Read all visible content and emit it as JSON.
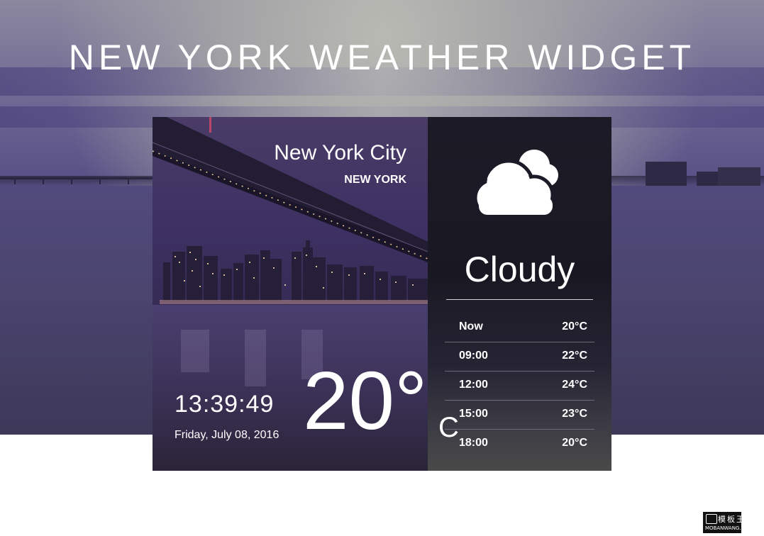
{
  "page": {
    "title": "NEW YORK WEATHER WIDGET"
  },
  "location": {
    "city": "New York City",
    "state": "NEW YORK"
  },
  "time": {
    "clock": "13:39:49",
    "date": "Friday, July 08, 2016"
  },
  "current": {
    "temperature": "20°",
    "unit": "C",
    "condition": "Cloudy",
    "icon": "cloud-icon"
  },
  "forecast": [
    {
      "time": "Now",
      "temp": "20°C"
    },
    {
      "time": "09:00",
      "temp": "22°C"
    },
    {
      "time": "12:00",
      "temp": "24°C"
    },
    {
      "time": "15:00",
      "temp": "23°C"
    },
    {
      "time": "18:00",
      "temp": "20°C"
    }
  ],
  "watermark": {
    "logo_text": "模板王",
    "logo_subtext": "MOBANWANG.COM"
  },
  "colors": {
    "info_panel": "#1c1a26",
    "sky": "#6c6592",
    "text": "#ffffff"
  }
}
